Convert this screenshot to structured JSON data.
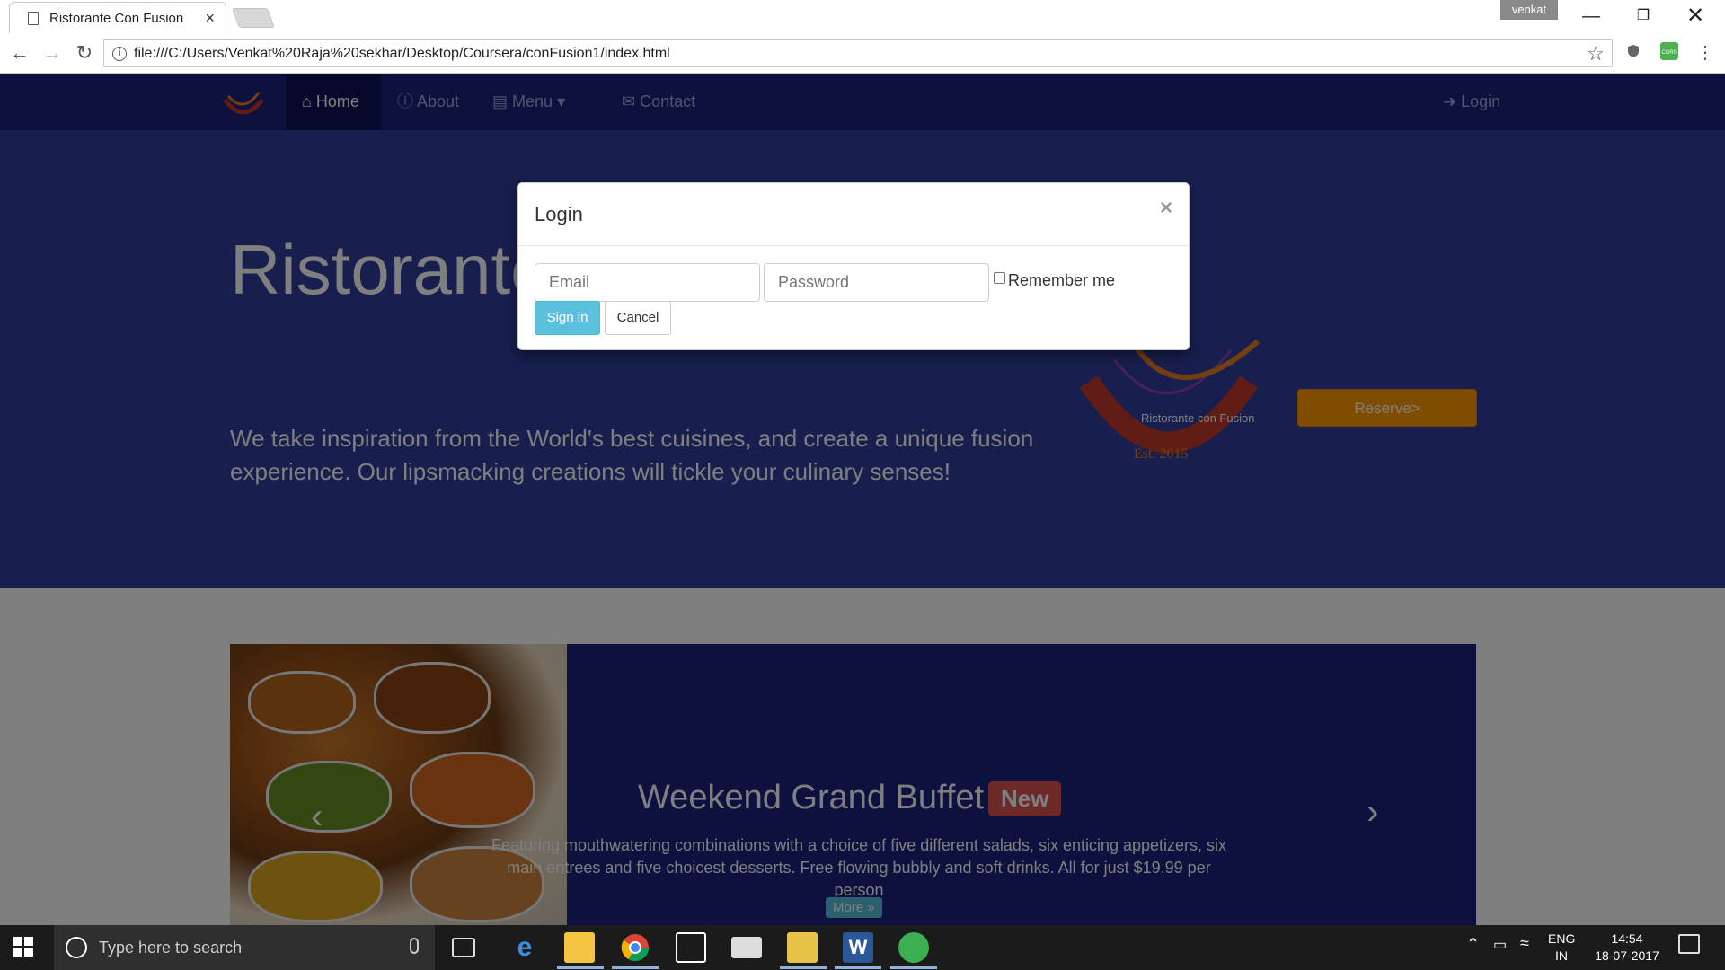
{
  "browser": {
    "tab_title": "Ristorante Con Fusion",
    "tab_close": "×",
    "profile": "venkat",
    "url": "file:///C:/Users/Venkat%20Raja%20sekhar/Desktop/Coursera/conFusion1/index.html",
    "ext_cors": "CORS"
  },
  "nav": {
    "home": "Home",
    "about": "About",
    "menu": "Menu",
    "contact": "Contact",
    "login": "Login"
  },
  "jumbotron": {
    "title": "Ristorante con Fusion",
    "text": "We take inspiration from the World's best cuisines, and create a unique fusion experience. Our lipsmacking creations will tickle your culinary senses!",
    "reserve": "Reserve>",
    "logo_text": "Ristorante con Fusion",
    "logo_est": "Est. 2015"
  },
  "carousel": {
    "heading": "Weekend Grand Buffet",
    "badge": "New",
    "caption": "Featuring mouthwatering combinations with a choice of five different salads, six enticing appetizers, six main entrees and five choicest desserts. Free flowing bubbly and soft drinks. All for just $19.99 per person",
    "more": "More »"
  },
  "modal": {
    "title": "Login",
    "close": "×",
    "email_placeholder": "Email",
    "password_placeholder": "Password",
    "remember": "Remember me",
    "signin": "Sign in",
    "cancel": "Cancel"
  },
  "taskbar": {
    "search_placeholder": "Type here to search",
    "lang": "ENG",
    "region": "IN",
    "time": "14:54",
    "date": "18-07-2017"
  },
  "colors": {
    "navbar": "#1a237e",
    "jumbotron": "#303f9f",
    "reserve": "#ff9800",
    "info": "#5bc0de",
    "badge": "#d9534f"
  }
}
